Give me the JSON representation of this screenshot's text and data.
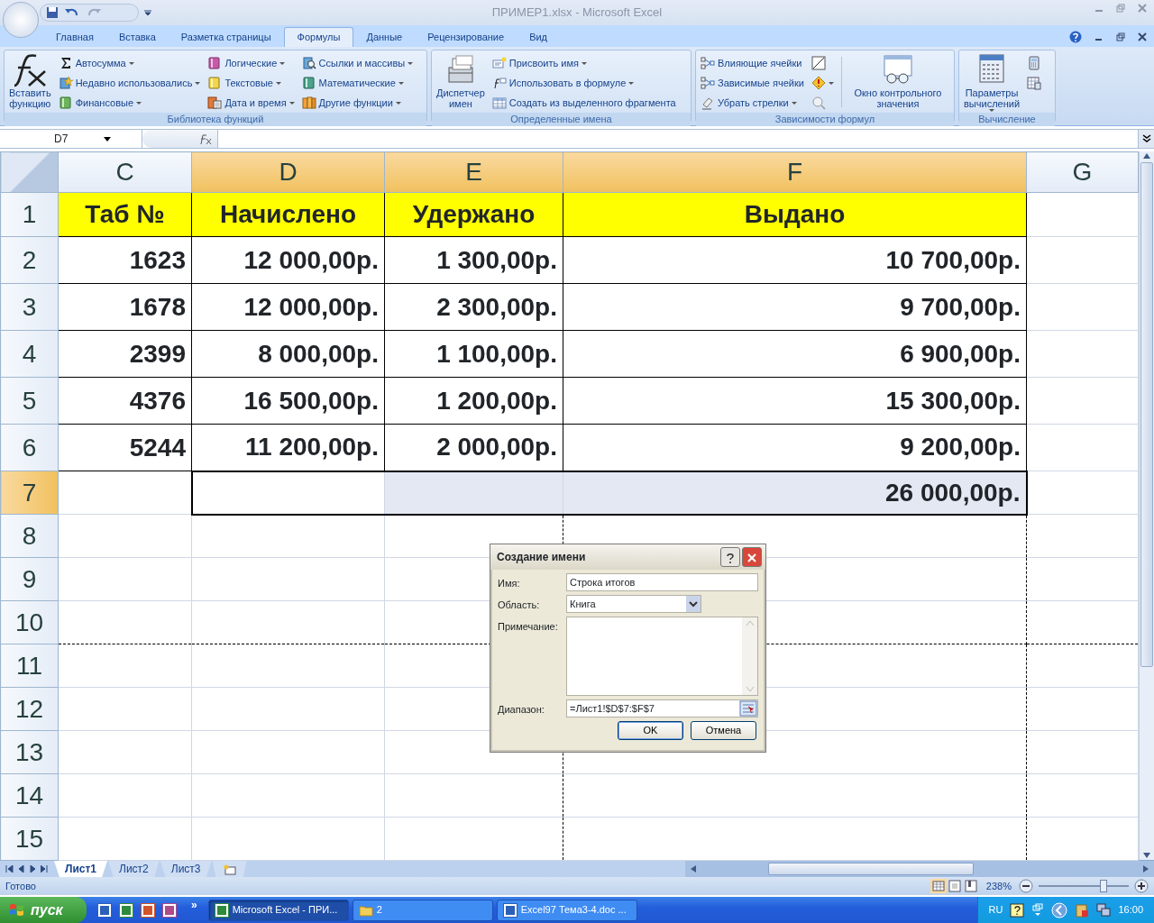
{
  "window": {
    "title": "ПРИМЕР1.xlsx - Microsoft Excel"
  },
  "ribbon_tabs": [
    {
      "label": "Главная",
      "selected": false
    },
    {
      "label": "Вставка",
      "selected": false
    },
    {
      "label": "Разметка страницы",
      "selected": false
    },
    {
      "label": "Формулы",
      "selected": true
    },
    {
      "label": "Данные",
      "selected": false
    },
    {
      "label": "Рецензирование",
      "selected": false
    },
    {
      "label": "Вид",
      "selected": false
    }
  ],
  "ribbon_groups": [
    {
      "label": "Библиотека функций",
      "items": [
        {
          "kind": "large",
          "label": "Вставить функцию",
          "dropdown": false
        },
        {
          "kind": "small",
          "label": "Автосумма",
          "dropdown": true
        },
        {
          "kind": "small",
          "label": "Недавно использовались",
          "dropdown": true
        },
        {
          "kind": "small",
          "label": "Финансовые",
          "dropdown": true
        },
        {
          "kind": "small",
          "label": "Логические",
          "dropdown": true
        },
        {
          "kind": "small",
          "label": "Текстовые",
          "dropdown": true
        },
        {
          "kind": "small",
          "label": "Дата и время",
          "dropdown": true
        },
        {
          "kind": "small",
          "label": "Ссылки и массивы",
          "dropdown": true
        },
        {
          "kind": "small",
          "label": "Математические",
          "dropdown": true
        },
        {
          "kind": "small",
          "label": "Другие функции",
          "dropdown": true
        }
      ]
    },
    {
      "label": "Определенные имена",
      "items": [
        {
          "kind": "large",
          "label": "Диспетчер имен",
          "dropdown": false
        },
        {
          "kind": "small",
          "label": "Присвоить имя",
          "dropdown": true
        },
        {
          "kind": "small",
          "label": "Использовать в формуле",
          "dropdown": true
        },
        {
          "kind": "small",
          "label": "Создать из выделенного фрагмента",
          "dropdown": false
        }
      ]
    },
    {
      "label": "Зависимости формул",
      "items": [
        {
          "kind": "small",
          "label": "Влияющие ячейки",
          "dropdown": false
        },
        {
          "kind": "small",
          "label": "Зависимые ячейки",
          "dropdown": false
        },
        {
          "kind": "small",
          "label": "Убрать стрелки",
          "dropdown": true
        },
        {
          "kind": "icon",
          "dropdown": false
        },
        {
          "kind": "icon",
          "dropdown": true
        },
        {
          "kind": "icon",
          "dropdown": false
        },
        {
          "kind": "large",
          "label": "Окно контрольного значения",
          "dropdown": false
        }
      ]
    },
    {
      "label": "Вычисление",
      "items": [
        {
          "kind": "large",
          "label": "Параметры вычислений",
          "dropdown": true
        },
        {
          "kind": "icon",
          "dropdown": false
        },
        {
          "kind": "icon",
          "dropdown": false
        }
      ]
    }
  ],
  "formula_bar": {
    "name_box": "D7"
  },
  "columns": [
    {
      "label": "C",
      "selected": false,
      "page_break": false
    },
    {
      "label": "D",
      "selected": true,
      "page_break": false
    },
    {
      "label": "E",
      "selected": true,
      "page_break": true
    },
    {
      "label": "F",
      "selected": true,
      "page_break": true
    },
    {
      "label": "G",
      "selected": false,
      "page_break": false
    }
  ],
  "rows": [
    {
      "number": "1",
      "kind": "heading",
      "selected": false,
      "cells": [
        "Таб №",
        "Начислено",
        "Удержано",
        "Выдано"
      ]
    },
    {
      "number": "2",
      "kind": "data",
      "selected": false,
      "cells": [
        "1623",
        "12 000,00р.",
        "1 300,00р.",
        "10 700,00р."
      ]
    },
    {
      "number": "3",
      "kind": "data",
      "selected": false,
      "cells": [
        "1678",
        "12 000,00р.",
        "2 300,00р.",
        "9 700,00р."
      ]
    },
    {
      "number": "4",
      "kind": "data",
      "selected": false,
      "cells": [
        "2399",
        "8 000,00р.",
        "1 100,00р.",
        "6 900,00р."
      ]
    },
    {
      "number": "5",
      "kind": "data",
      "selected": false,
      "cells": [
        "4376",
        "16 500,00р.",
        "1 200,00р.",
        "15 300,00р."
      ]
    },
    {
      "number": "6",
      "kind": "data",
      "selected": false,
      "cells": [
        "5244",
        "11 200,00р.",
        "2 000,00р.",
        "9 200,00р."
      ]
    },
    {
      "number": "7",
      "kind": "total",
      "selected": true,
      "cells": [
        null,
        null,
        null,
        "26 000,00р."
      ]
    },
    {
      "number": "8",
      "kind": "blank",
      "selected": false
    },
    {
      "number": "9",
      "kind": "blank",
      "selected": false
    },
    {
      "number": "10",
      "kind": "blank",
      "selected": false,
      "page_break": true
    },
    {
      "number": "11",
      "kind": "blank",
      "selected": false
    },
    {
      "number": "12",
      "kind": "blank",
      "selected": false
    },
    {
      "number": "13",
      "kind": "blank",
      "selected": false
    },
    {
      "number": "14",
      "kind": "blank",
      "selected": false
    },
    {
      "number": "15",
      "kind": "blank",
      "selected": false
    }
  ],
  "dialog": {
    "title": "Создание имени",
    "fields": [
      {
        "kind": "text",
        "label": "Имя:",
        "value": "Строка итогов"
      },
      {
        "kind": "select",
        "label": "Область:",
        "value": "Книга"
      },
      {
        "kind": "textarea",
        "label": "Примечание:"
      },
      {
        "kind": "range",
        "label": "Диапазон:",
        "value": "=Лист1!$D$7:$F$7"
      }
    ],
    "buttons": [
      {
        "label": "OK",
        "default": true
      },
      {
        "label": "Отмена",
        "default": false
      }
    ]
  },
  "sheet_tabs": [
    {
      "label": "Лист1",
      "selected": true
    },
    {
      "label": "Лист2",
      "selected": false
    },
    {
      "label": "Лист3",
      "selected": false
    }
  ],
  "status_bar": {
    "text": "Готово",
    "zoom": "238%",
    "zoom_level": {
      "level": 0.72
    }
  },
  "taskbar": {
    "start": "пуск",
    "more": "»",
    "tasks": [
      {
        "label": "Microsoft Excel - ПРИ...",
        "selected": true
      },
      {
        "label": "2",
        "selected": false
      },
      {
        "label": "Excel97 Тема3-4.doc ...",
        "selected": false
      }
    ],
    "language": "RU",
    "clock": "16:00"
  }
}
